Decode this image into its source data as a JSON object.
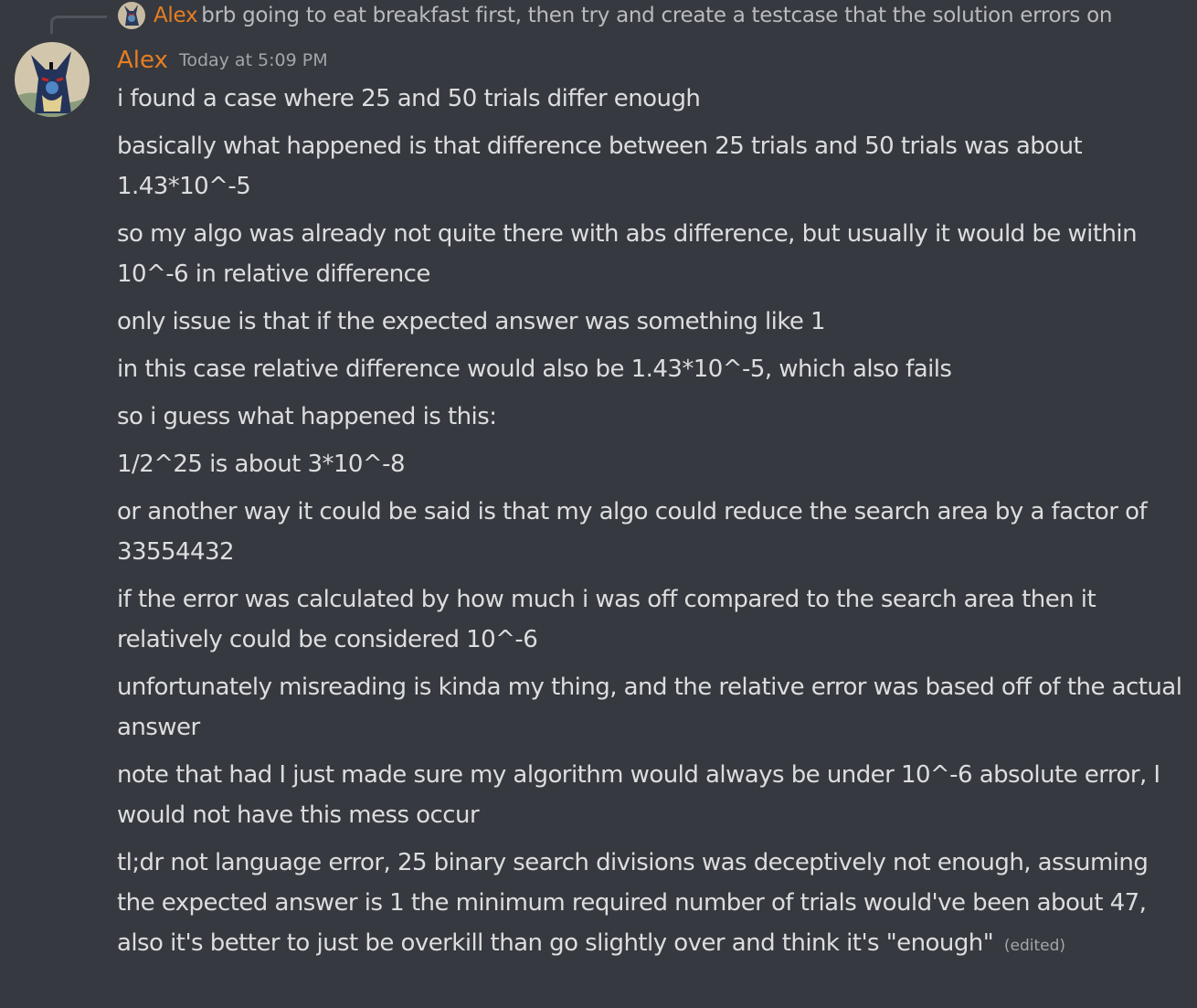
{
  "reply": {
    "author": "Alex",
    "text": "brb going to eat breakfast first, then try and create a testcase that the solution errors on"
  },
  "message": {
    "author": "Alex",
    "timestamp": "Today at 5:09 PM",
    "lines": [
      "i found a case where 25 and 50 trials differ enough",
      "basically what happened is that difference between 25 trials and 50 trials was about 1.43*10^-5",
      "so my algo was already not quite there with abs difference, but usually it would be within 10^-6 in relative difference",
      "only issue is that if the expected answer was something like 1",
      "in this case relative difference would also be 1.43*10^-5, which also fails",
      "so i guess what happened is this:",
      "1/2^25 is about 3*10^-8",
      "or another way it could be said is that my algo could reduce the search area by a factor of 33554432",
      "if the error was calculated by how much i was off compared to the search area then it relatively could be considered 10^-6",
      "unfortunately misreading is kinda my thing, and the relative error was based off of the actual answer",
      "note that had I just made sure my algorithm would always be under 10^-6 absolute error, I would not have this mess occur",
      "tl;dr not language error, 25 binary search divisions was deceptively not enough, assuming the expected answer is 1 the minimum required number of trials would've been about 47, also it's better to just be overkill than go slightly over and think it's \"enough\""
    ],
    "edited_label": "(edited)"
  },
  "colors": {
    "background": "#36393f",
    "author": "#e67e22",
    "text": "#dcddde",
    "muted": "#a3a6aa"
  }
}
